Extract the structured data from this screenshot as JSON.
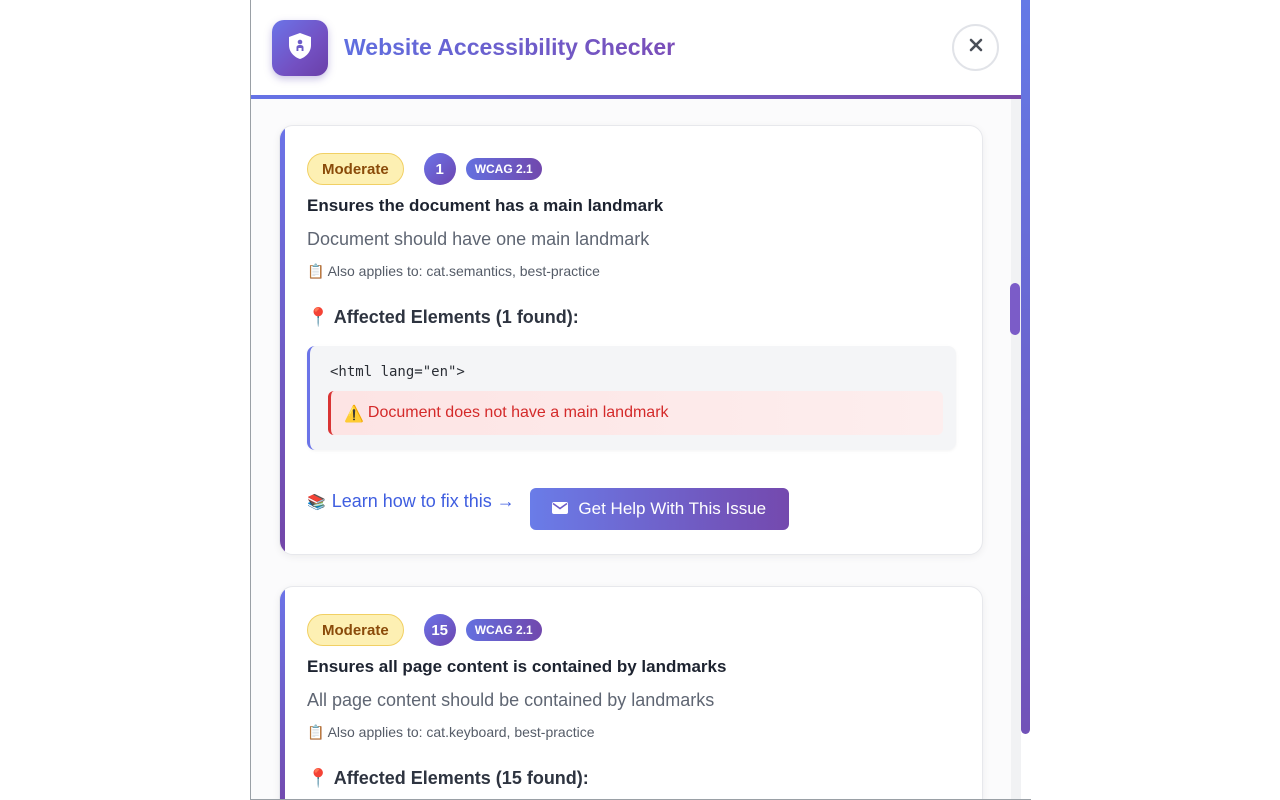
{
  "app": {
    "title": "Website Accessibility Checker",
    "logo_icon": "shield-person-icon",
    "close_icon": "close-icon"
  },
  "colors": {
    "accent_start": "#6b74e8",
    "accent_end": "#7346a8",
    "moderate_bg": "#fdf0b3",
    "moderate_text": "#8a4b0a",
    "failure_text": "#d42a2a",
    "link": "#3f5ee0"
  },
  "issues": [
    {
      "severity": "Moderate",
      "count": "1",
      "wcag": "WCAG 2.1",
      "title": "Ensures the document has a main landmark",
      "description": "Document should have one main landmark",
      "applies_icon": "📋",
      "applies_to": "Also applies to: cat.semantics, best-practice",
      "affected_icon": "📍",
      "affected_label": "Affected Elements (1 found):",
      "elements": [
        {
          "code": "<html lang=\"en\">",
          "failure_icon": "⚠️",
          "failure": "Document does not have a main landmark"
        }
      ],
      "learn_icon": "📚",
      "learn_link": "Learn how to fix this →",
      "help_icon": "envelope-icon",
      "help_button": "Get Help With This Issue"
    },
    {
      "severity": "Moderate",
      "count": "15",
      "wcag": "WCAG 2.1",
      "title": "Ensures all page content is contained by landmarks",
      "description": "All page content should be contained by landmarks",
      "applies_icon": "📋",
      "applies_to": "Also applies to: cat.keyboard, best-practice",
      "affected_icon": "📍",
      "affected_label": "Affected Elements (15 found):"
    }
  ]
}
